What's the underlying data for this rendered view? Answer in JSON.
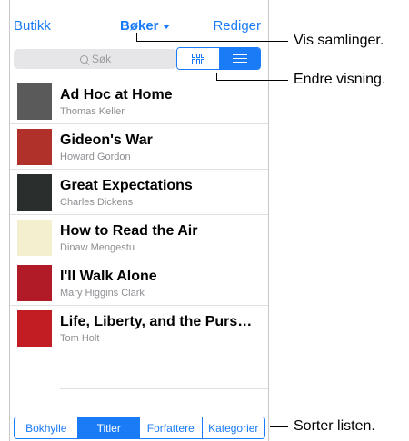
{
  "navbar": {
    "left": "Butikk",
    "title": "Bøker",
    "right": "Rediger"
  },
  "search": {
    "placeholder": "Søk"
  },
  "view_toggle": {
    "grid_icon": "grid-icon",
    "list_icon": "list-icon",
    "selected": "list"
  },
  "books": [
    {
      "title": "Ad Hoc at Home",
      "author": "Thomas Keller",
      "cover_color": "#5a5a5a"
    },
    {
      "title": "Gideon's War",
      "author": "Howard Gordon",
      "cover_color": "#b0302a"
    },
    {
      "title": "Great Expectations",
      "author": "Charles Dickens",
      "cover_color": "#2a2f2e"
    },
    {
      "title": "How to Read the Air",
      "author": "Dinaw Mengestu",
      "cover_color": "#f3efcf"
    },
    {
      "title": "I'll Walk Alone",
      "author": "Mary Higgins Clark",
      "cover_color": "#b11a27"
    },
    {
      "title": "Life, Liberty, and the Purs…",
      "author": "Tom Holt",
      "cover_color": "#c21d22"
    }
  ],
  "sort_tabs": [
    {
      "label": "Bokhylle"
    },
    {
      "label": "Titler",
      "active": true
    },
    {
      "label": "Forfattere"
    },
    {
      "label": "Kategorier"
    }
  ],
  "callouts": {
    "collections": "Vis samlinger.",
    "change_view": "Endre visning.",
    "sort": "Sorter listen."
  },
  "colors": {
    "accent": "#1a7bf7"
  }
}
